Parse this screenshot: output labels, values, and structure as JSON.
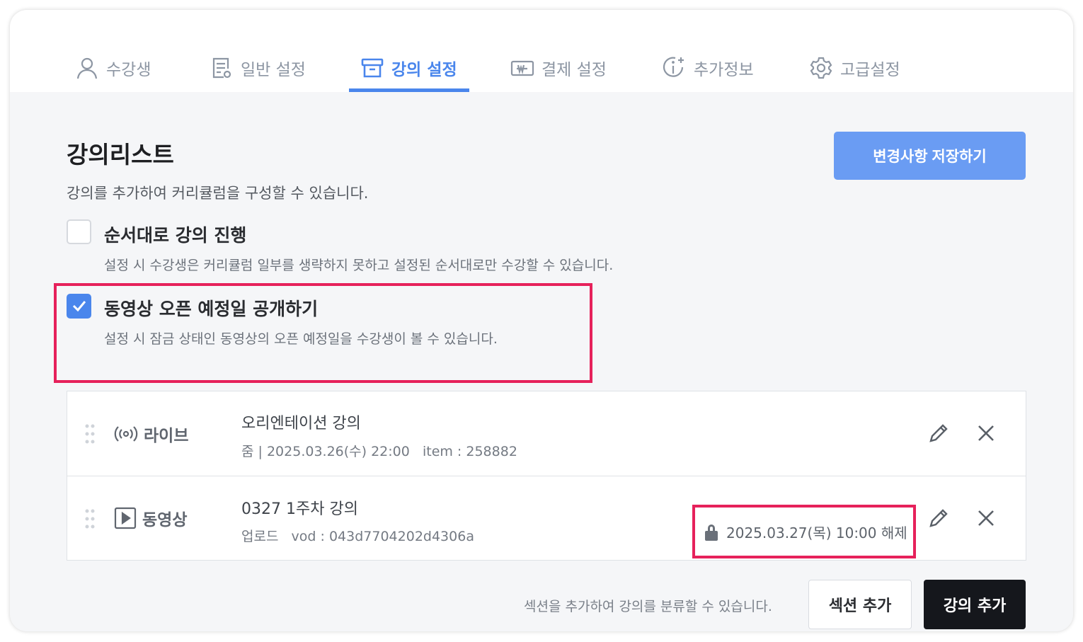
{
  "tabs": [
    {
      "label": "수강생",
      "icon": "user-icon"
    },
    {
      "label": "일반 설정",
      "icon": "document-settings-icon"
    },
    {
      "label": "강의 설정",
      "icon": "archive-box-icon",
      "active": true
    },
    {
      "label": "결제 설정",
      "icon": "won-bill-icon"
    },
    {
      "label": "추가정보",
      "icon": "info-plus-icon"
    },
    {
      "label": "고급설정",
      "icon": "gear-icon"
    }
  ],
  "page": {
    "title": "강의리스트",
    "subtitle": "강의를 추가하여 커리큘럼을 구성할 수 있습니다.",
    "save_label": "변경사항 저장하기"
  },
  "options": [
    {
      "label": "순서대로 강의 진행",
      "desc": "설정 시 수강생은 커리큘럼 일부를 생략하지 못하고 설정된 순서대로만 수강할 수 있습니다.",
      "checked": false
    },
    {
      "label": "동영상 오픈 예정일 공개하기",
      "desc": "설정 시 잠금 상태인 동영상의 오픈 예정일을 수강생이 볼 수 있습니다.",
      "checked": true
    }
  ],
  "lectures": [
    {
      "type": "라이브",
      "icon": "live-broadcast-icon",
      "title": "오리엔테이션 강의",
      "meta": "줌 | 2025.03.26(수) 22:00   item : 258882"
    },
    {
      "type": "동영상",
      "icon": "video-play-icon",
      "title": "0327 1주차 강의",
      "meta": "업로드   vod : 043d7704202d4306a",
      "lock_note": "2025.03.27(목) 10:00 해제"
    }
  ],
  "footer": {
    "hint": "섹션을 추가하여 강의를 분류할 수 있습니다.",
    "add_section": "섹션 추가",
    "add_lecture": "강의 추가"
  },
  "colors": {
    "accent": "#4a86ec",
    "save_button": "#6a9cf3",
    "highlight": "#e6215b",
    "dark_button": "#15171c"
  }
}
